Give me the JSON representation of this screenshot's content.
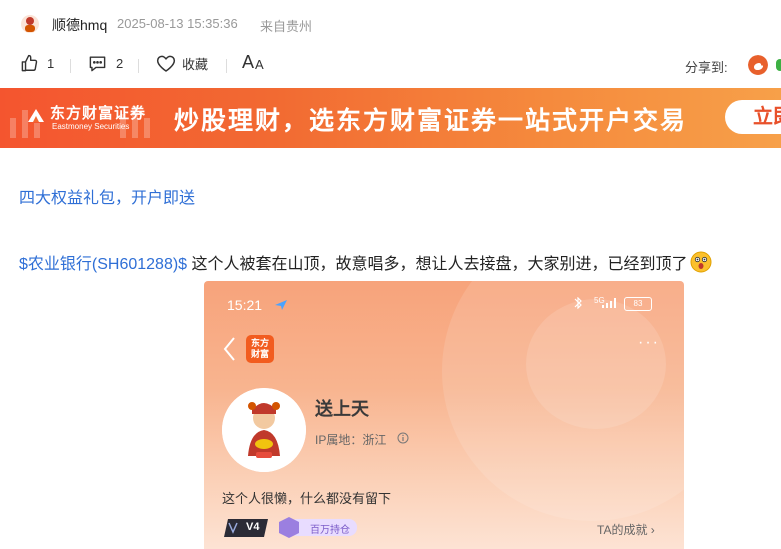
{
  "header": {
    "username": "顺德hmq",
    "datetime": "2025-08-13 15:35:36",
    "source": "来自贵州"
  },
  "actions": {
    "like_count": "1",
    "comment_count": "2",
    "favorite_label": "收藏",
    "font_size_label_big": "A",
    "font_size_label_small": "A",
    "share_label": "分享到:"
  },
  "banner": {
    "logo_cn": "东方财富证券",
    "logo_en": "Eastmoney Securities",
    "slogan": "炒股理财，选东方财富证券一站式开户交易",
    "button_label": "立即"
  },
  "post": {
    "promo_link": "四大权益礼包，开户即送",
    "stock_tag": "$农业银行(SH601288)$",
    "text": " 这个人被套在山顶，故意唱多，想让人去接盘，大家别进，已经到顶了"
  },
  "phone_screenshot": {
    "time": "15:21",
    "network": "5G",
    "battery": "83",
    "app_logo_line1": "东方",
    "app_logo_line2": "财富",
    "profile_name": "送上天",
    "ip_label": "IP属地：浙江",
    "bio": "这个人很懒，什么都没有留下",
    "level_badge": "V4",
    "holding_badge": "百万持仓",
    "achievement_link": "TA的成就 ›"
  },
  "colors": {
    "link_blue": "#2f6fd6",
    "brand_orange": "#f4552f"
  },
  "icons": {
    "like": "thumbs-up-icon",
    "comment": "comment-icon",
    "favorite": "heart-icon",
    "share_weibo": "weibo-icon",
    "emoji": "surprised-face-icon"
  }
}
